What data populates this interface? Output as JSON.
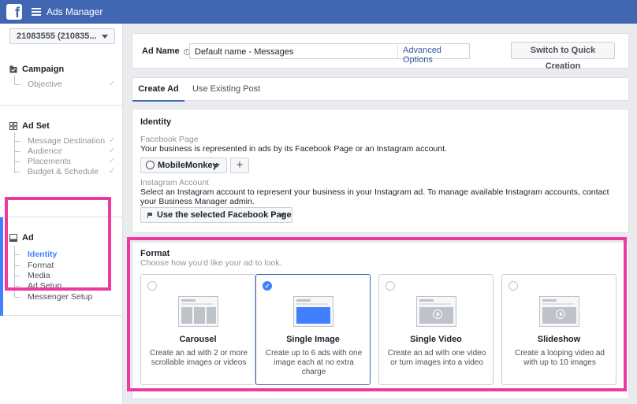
{
  "app": {
    "title": "Ads Manager",
    "logo_letter": "f"
  },
  "sidebar": {
    "account": "21083555 (210835...",
    "campaign": {
      "title": "Campaign",
      "items": [
        {
          "label": "Objective",
          "check": "✓"
        }
      ]
    },
    "adset": {
      "title": "Ad Set",
      "items": [
        {
          "label": "Message Destination",
          "check": "✓"
        },
        {
          "label": "Audience",
          "check": "✓"
        },
        {
          "label": "Placements",
          "check": "✓"
        },
        {
          "label": "Budget & Schedule",
          "check": "✓"
        }
      ]
    },
    "ad": {
      "title": "Ad",
      "items": [
        {
          "label": "Identity"
        },
        {
          "label": "Format"
        },
        {
          "label": "Media"
        },
        {
          "label": "Ad Setup"
        },
        {
          "label": "Messenger Setup"
        }
      ]
    }
  },
  "adname": {
    "label": "Ad Name",
    "info": "i",
    "value": "Default name - Messages",
    "advanced": "Advanced Options",
    "quick_button": "Switch to Quick Creation"
  },
  "tabs": {
    "create": "Create Ad",
    "existing": "Use Existing Post"
  },
  "identity": {
    "title": "Identity",
    "fb_label": "Facebook Page",
    "fb_desc": "Your business is represented in ads by its Facebook Page or an Instagram account.",
    "page_button": "MobileMonkey",
    "plus": "+",
    "ig_label": "Instagram Account",
    "ig_desc": "Select an Instagram account to represent your business in your Instagram ad. To manage available Instagram accounts, contact your Business Manager admin.",
    "ig_button": "Use the selected Facebook Page"
  },
  "format": {
    "title": "Format",
    "subtitle": "Choose how you'd like your ad to look.",
    "selected_mark": "✓",
    "cards": [
      {
        "title": "Carousel",
        "desc": "Create an ad with 2 or more scrollable images or videos"
      },
      {
        "title": "Single Image",
        "desc": "Create up to 6 ads with one image each at no extra charge"
      },
      {
        "title": "Single Video",
        "desc": "Create an ad with one video or turn images into a video"
      },
      {
        "title": "Slideshow",
        "desc": "Create a looping video ad with up to 10 images"
      }
    ],
    "selected_index": 1
  },
  "colors": {
    "brand": "#4267b2",
    "accent": "#4080ff",
    "highlight": "#ee3aa0"
  }
}
